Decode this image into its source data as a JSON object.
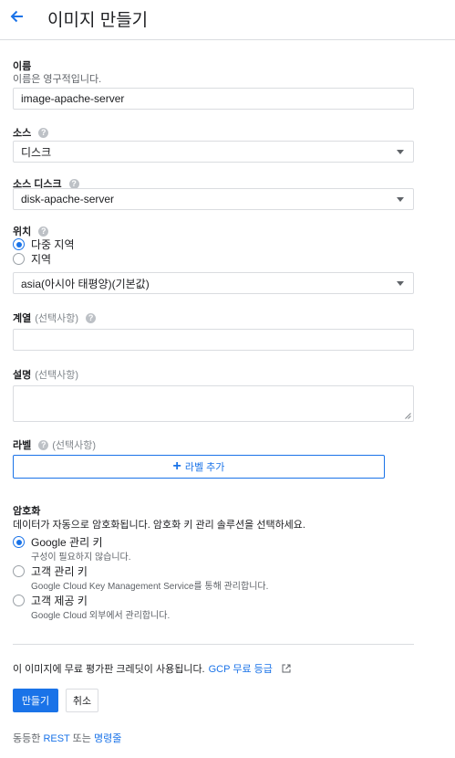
{
  "header": {
    "title": "이미지 만들기"
  },
  "name": {
    "label": "이름",
    "hint": "이름은 영구적입니다.",
    "value": "image-apache-server"
  },
  "source": {
    "label": "소스",
    "value": "디스크"
  },
  "source_disk": {
    "label": "소스 디스크",
    "value": "disk-apache-server"
  },
  "location": {
    "label": "위치",
    "options": [
      "다중 지역",
      "지역"
    ],
    "selected": 0,
    "region_value": "asia(아시아 태평양)(기본값)"
  },
  "family": {
    "label": "계열",
    "optional": "(선택사항)",
    "value": ""
  },
  "description": {
    "label": "설명",
    "optional": "(선택사항)",
    "value": ""
  },
  "labels": {
    "label": "라벨",
    "optional": "(선택사항)",
    "add_button": "라벨 추가"
  },
  "encryption": {
    "label": "암호화",
    "hint": "데이터가 자동으로 암호화됩니다. 암호화 키 관리 솔루션을 선택하세요.",
    "options": [
      {
        "title": "Google 관리 키",
        "desc": "구성이 필요하지 않습니다."
      },
      {
        "title": "고객 관리 키",
        "desc": "Google Cloud Key Management Service를 통해 관리합니다."
      },
      {
        "title": "고객 제공 키",
        "desc": "Google Cloud 외부에서 관리합니다."
      }
    ],
    "selected": 0
  },
  "credit": {
    "text": "이 이미지에 무료 평가판 크레딧이 사용됩니다.",
    "link": "GCP 무료 등급"
  },
  "actions": {
    "create": "만들기",
    "cancel": "취소"
  },
  "equivalent": {
    "prefix": "동등한",
    "rest": "REST",
    "or": "또는",
    "cli": "명령줄"
  },
  "colors": {
    "accent": "#1a73e8",
    "border": "#dadce0",
    "muted": "#5f6368",
    "help_icon": "#bdc1c6"
  },
  "icons": [
    "back-arrow-icon",
    "help-icon",
    "caret-down-icon",
    "plus-icon",
    "external-link-icon"
  ]
}
